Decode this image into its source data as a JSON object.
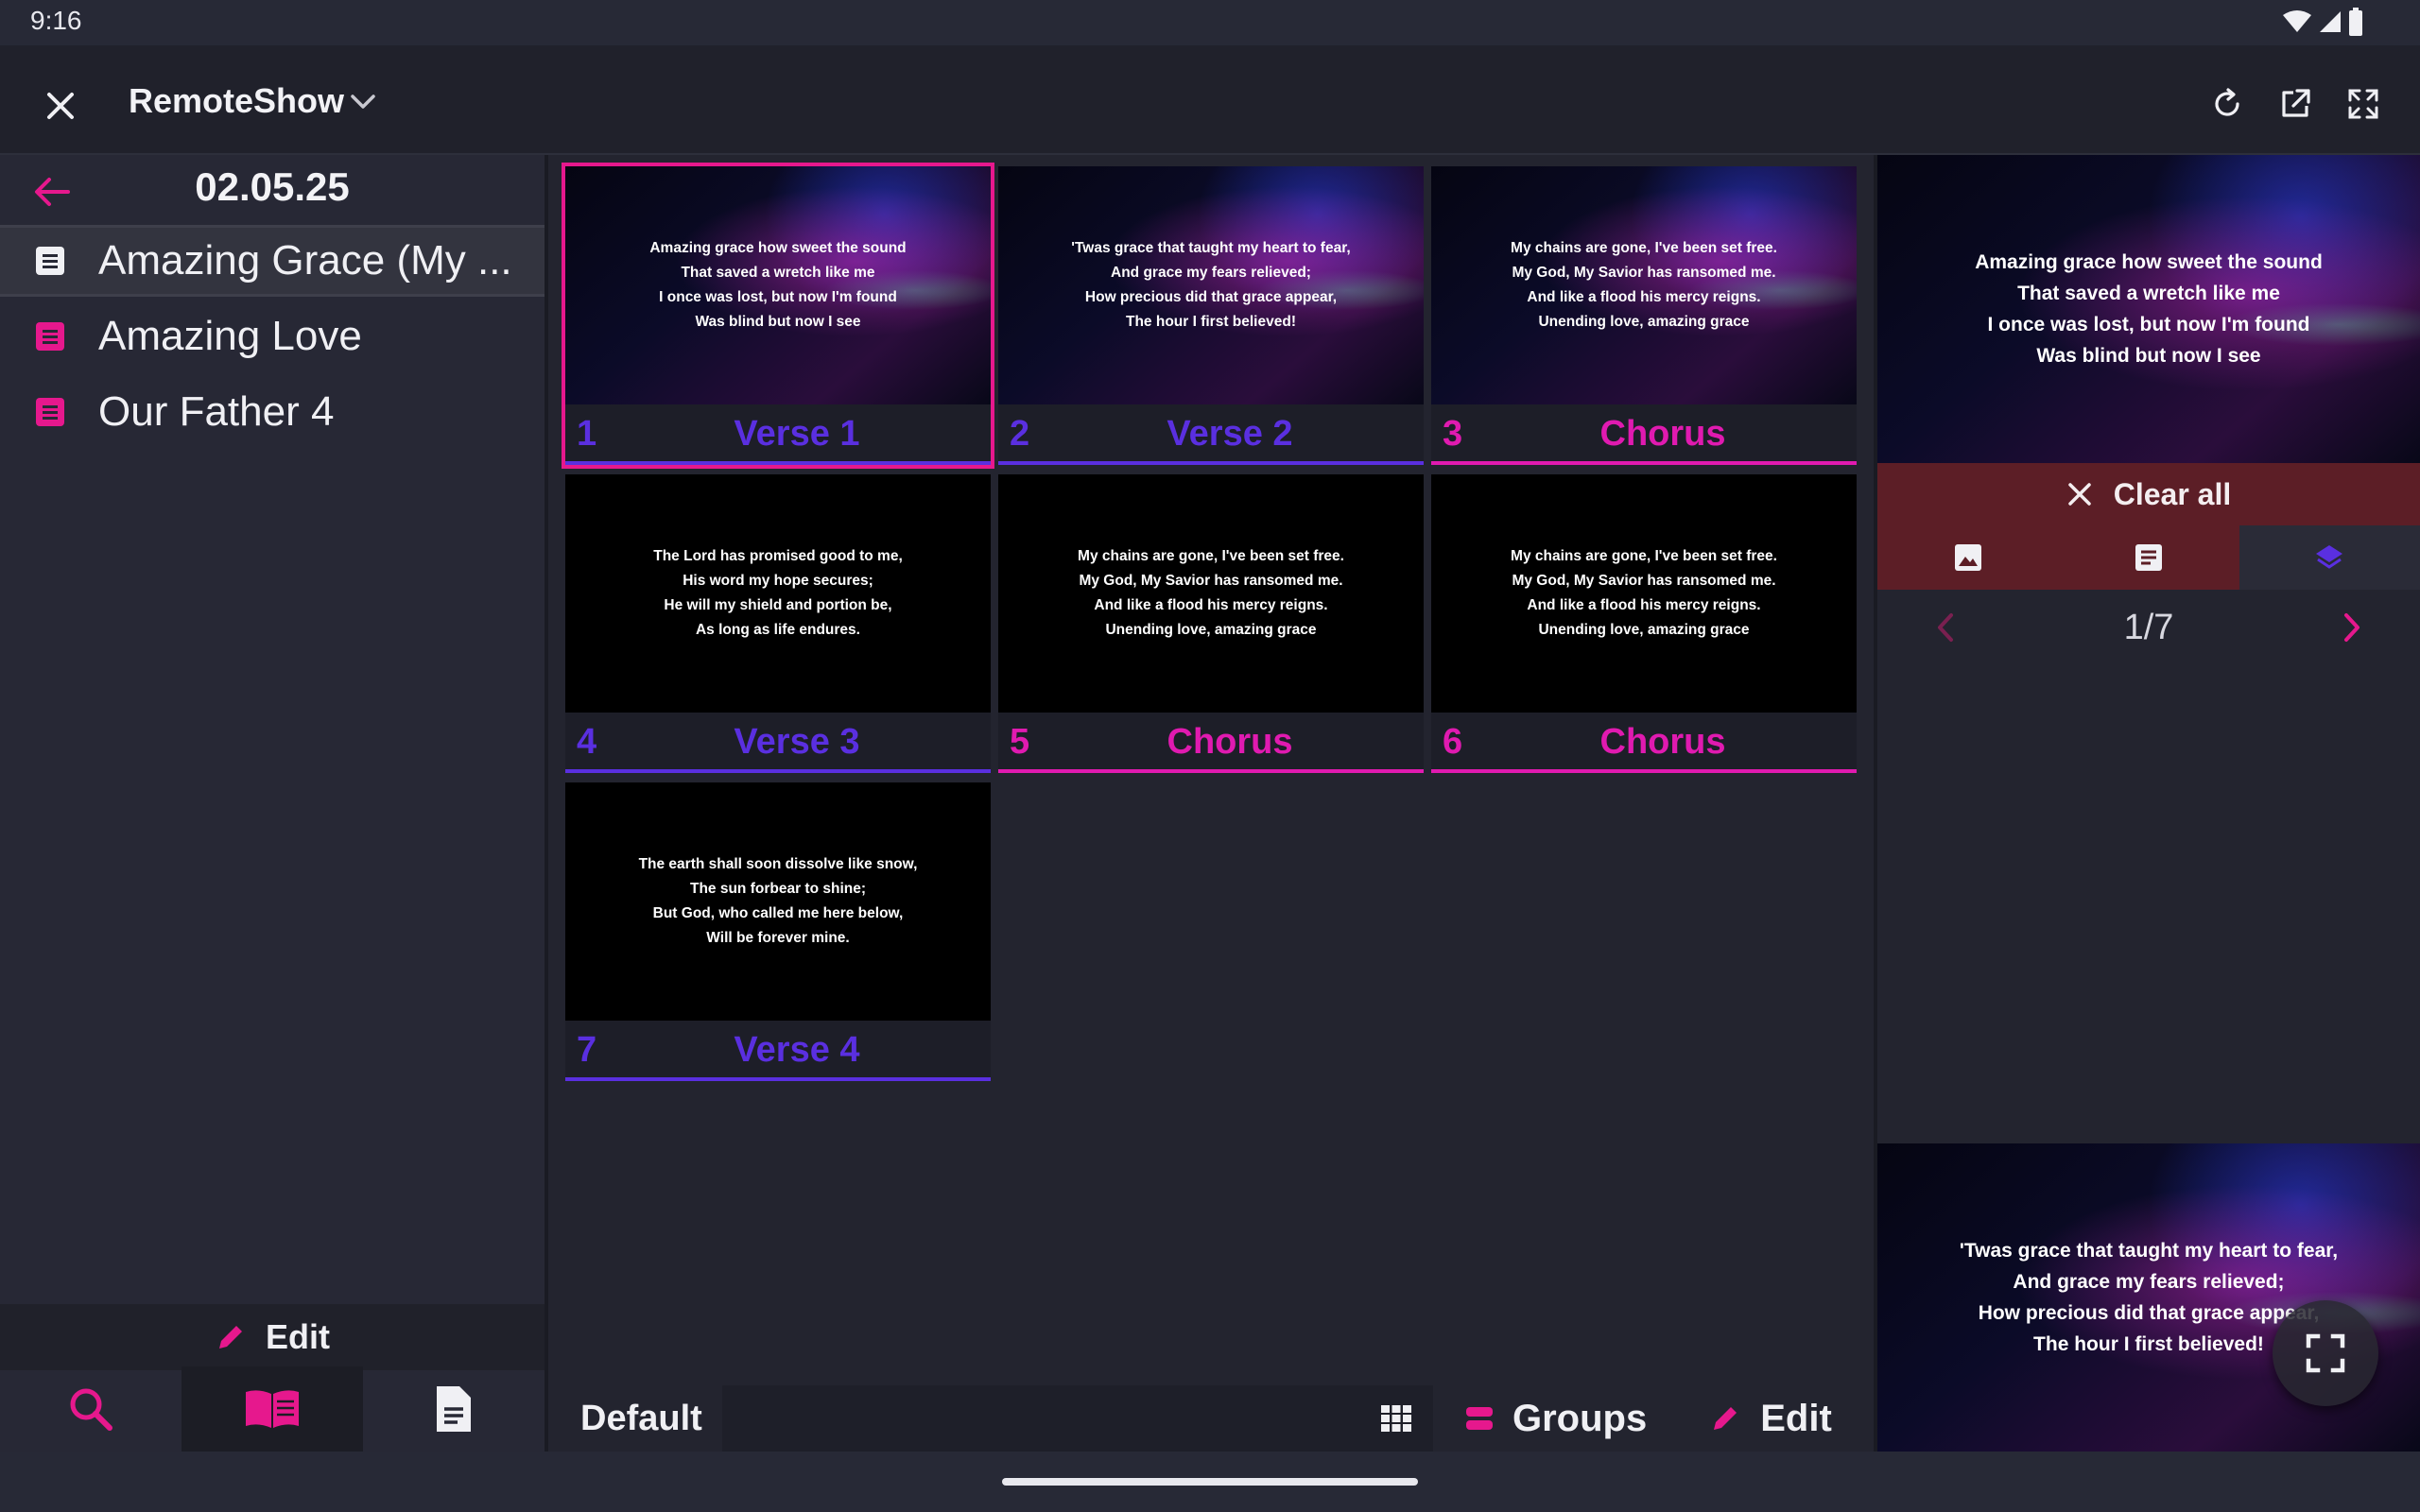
{
  "status_bar": {
    "time": "9:16"
  },
  "app_bar": {
    "title": "RemoteShow"
  },
  "sidebar": {
    "date": "02.05.25",
    "songs": [
      {
        "label": "Amazing Grace (My ...",
        "selected": true
      },
      {
        "label": "Amazing Love",
        "selected": false
      },
      {
        "label": "Our Father 4",
        "selected": false
      }
    ],
    "edit_label": "Edit"
  },
  "slides": [
    {
      "num": "1",
      "group": "Verse 1",
      "kind": "verse",
      "lyrics": "Amazing grace how sweet the sound\nThat saved a wretch like me\nI once was lost, but now I'm found\nWas blind but now I see"
    },
    {
      "num": "2",
      "group": "Verse 2",
      "kind": "verse",
      "lyrics": "'Twas grace that taught my heart to fear,\nAnd grace my fears relieved;\nHow precious did that grace appear,\nThe hour I first believed!"
    },
    {
      "num": "3",
      "group": "Chorus",
      "kind": "chorus",
      "lyrics": "My chains are gone, I've been set free.\nMy God, My Savior has ransomed me.\nAnd like a flood his mercy reigns.\nUnending love, amazing grace"
    },
    {
      "num": "4",
      "group": "Verse 3",
      "kind": "verse",
      "lyrics": "The Lord has promised good to me,\nHis word my hope secures;\nHe will my shield and portion be,\nAs long as life endures."
    },
    {
      "num": "5",
      "group": "Chorus",
      "kind": "chorus",
      "lyrics": "My chains are gone, I've been set free.\nMy God, My Savior has ransomed me.\nAnd like a flood his mercy reigns.\nUnending love, amazing grace"
    },
    {
      "num": "6",
      "group": "Chorus",
      "kind": "chorus",
      "lyrics": "My chains are gone, I've been set free.\nMy God, My Savior has ransomed me.\nAnd like a flood his mercy reigns.\nUnending love, amazing grace"
    },
    {
      "num": "7",
      "group": "Verse 4",
      "kind": "verse",
      "lyrics": "The earth shall soon dissolve like snow,\nThe sun forbear to shine;\nBut God, who called me here below,\nWill be forever mine."
    }
  ],
  "grid_footer": {
    "layout": "Default",
    "groups_label": "Groups",
    "edit_label": "Edit"
  },
  "preview": {
    "current_lyrics": "Amazing grace how sweet the sound\nThat saved a wretch like me\nI once was lost, but now I'm found\nWas blind but now I see",
    "clear_all_label": "Clear all",
    "page": "1/7",
    "next_lyrics": "'Twas grace that taught my heart to fear,\nAnd grace my fears relieved;\nHow precious did that grace appear,\nThe hour I first believed!"
  },
  "colors": {
    "accent": "#e6188d",
    "verse": "#5a2fe0",
    "chorus": "#e01ab0",
    "clear_all_bg": "#5c1e26"
  }
}
